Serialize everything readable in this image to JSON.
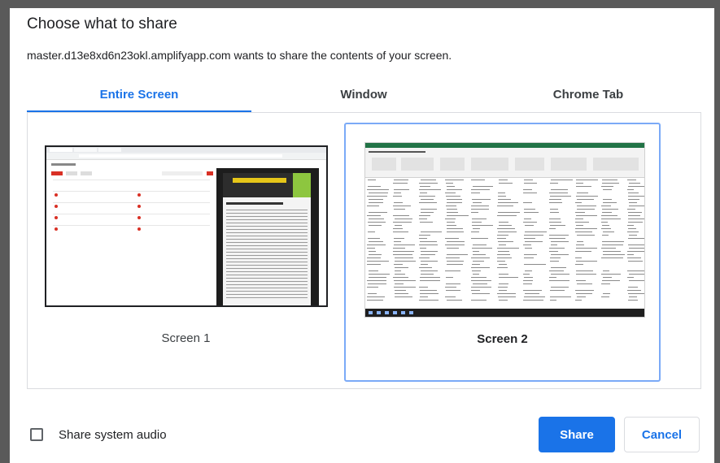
{
  "dialog": {
    "title": "Choose what to share",
    "subtitle": "master.d13e8xd6n23okl.amplifyapp.com wants to share the contents of your screen."
  },
  "tabs": [
    {
      "label": "Entire Screen",
      "active": true
    },
    {
      "label": "Window",
      "active": false
    },
    {
      "label": "Chrome Tab",
      "active": false
    }
  ],
  "screens": [
    {
      "label": "Screen 1",
      "selected": false
    },
    {
      "label": "Screen 2",
      "selected": true
    }
  ],
  "footer": {
    "audio_label": "Share system audio",
    "audio_checked": false,
    "share_label": "Share",
    "cancel_label": "Cancel"
  },
  "colors": {
    "accent": "#1a73e8",
    "selection_border": "#7baaf7",
    "excel_green": "#217346"
  }
}
